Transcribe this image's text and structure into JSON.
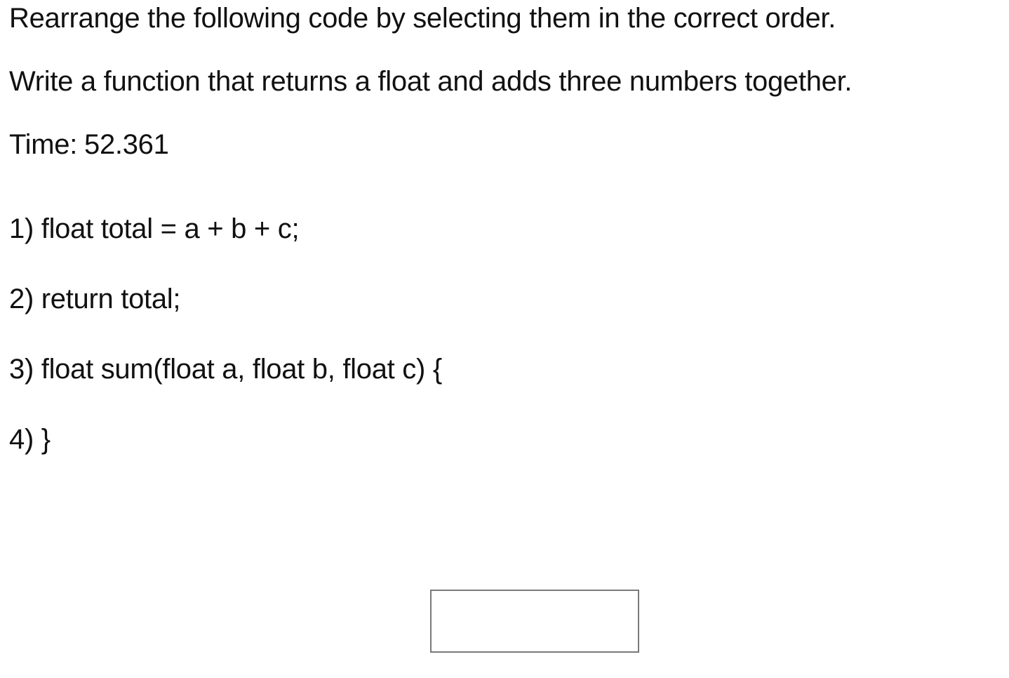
{
  "prompt": {
    "instruction": "Rearrange the following code by selecting them in the correct order.",
    "task": "Write a function that returns a float and adds three numbers together."
  },
  "timer": {
    "label": "Time:",
    "value": "52.361"
  },
  "options": [
    {
      "text": "1) float total = a + b + c;"
    },
    {
      "text": "2) return total;"
    },
    {
      "text": "3) float sum(float a, float b, float c) {"
    },
    {
      "text": "4) }"
    }
  ],
  "answer": {
    "value": ""
  }
}
